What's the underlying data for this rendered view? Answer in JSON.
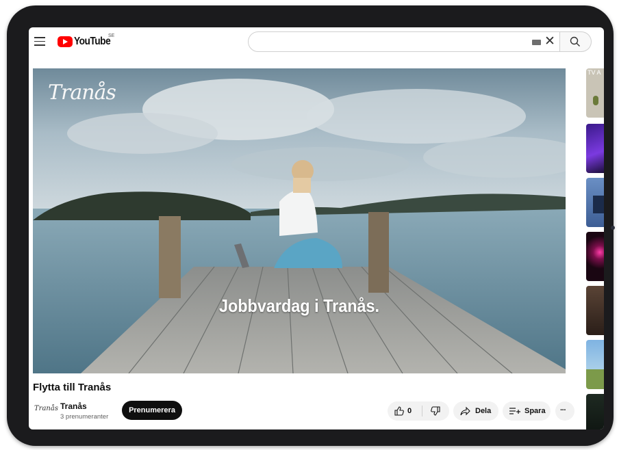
{
  "header": {
    "logo_text": "YouTube",
    "country_code": "SE",
    "search": {
      "placeholder": "",
      "value": ""
    }
  },
  "video": {
    "brand_overlay": "Tranås",
    "caption": "Jobbvardag i Tranås.",
    "title": "Flytta till Tranås"
  },
  "channel": {
    "logo_text": "Tranås",
    "name": "Tranås",
    "subscribers": "3 prenumeranter",
    "subscribe_label": "Prenumerera"
  },
  "actions": {
    "like_count": "0",
    "share_label": "Dela",
    "save_label": "Spara",
    "more_label": "···"
  },
  "related": {
    "first_label": "TV A"
  },
  "colors": {
    "brand_red": "#ff0000",
    "subscribe_bg": "#0f0f0f",
    "pill_bg": "#f2f2f2"
  }
}
